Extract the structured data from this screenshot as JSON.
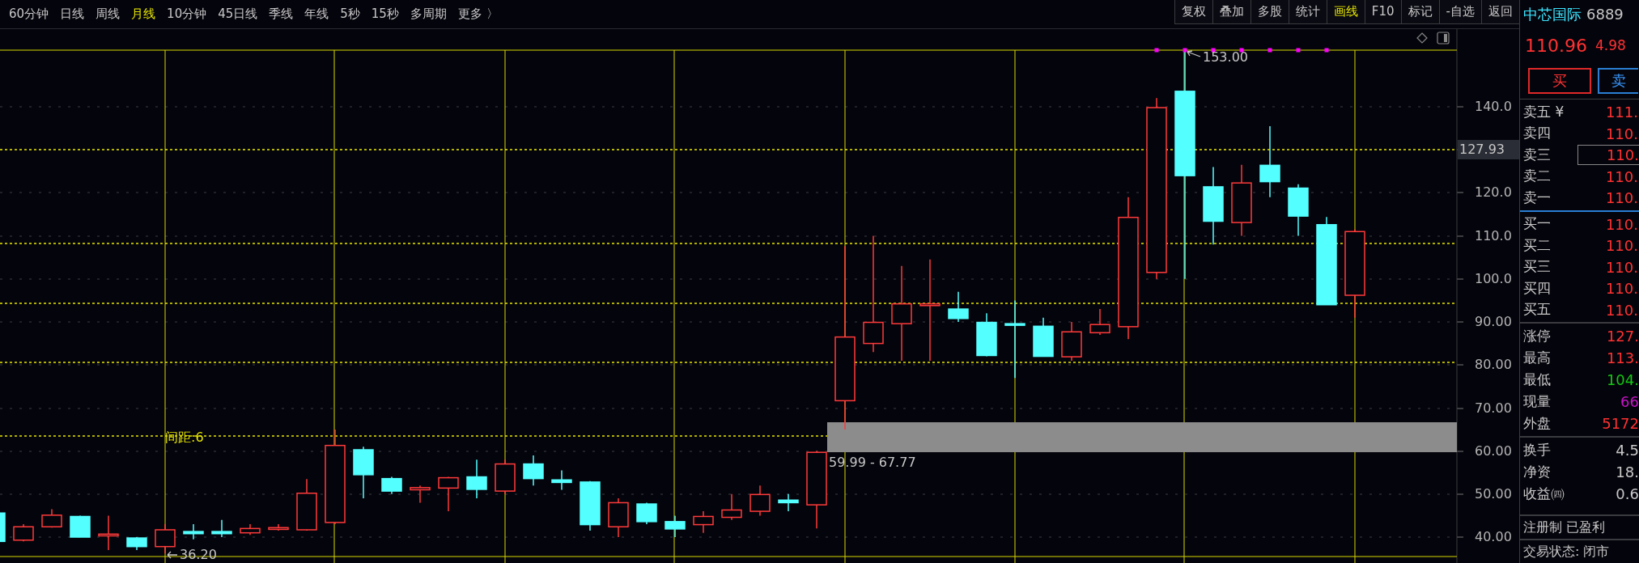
{
  "period_tabs": [
    {
      "label": "60分钟",
      "selected": false
    },
    {
      "label": "日线",
      "selected": false
    },
    {
      "label": "周线",
      "selected": false
    },
    {
      "label": "月线",
      "selected": true
    },
    {
      "label": "10分钟",
      "selected": false
    },
    {
      "label": "45日线",
      "selected": false
    },
    {
      "label": "季线",
      "selected": false
    },
    {
      "label": "年线",
      "selected": false
    },
    {
      "label": "5秒",
      "selected": false
    },
    {
      "label": "15秒",
      "selected": false
    },
    {
      "label": "多周期",
      "selected": false
    },
    {
      "label": "更多 〉",
      "selected": false
    }
  ],
  "tools": [
    {
      "label": "复权",
      "selected": false
    },
    {
      "label": "叠加",
      "selected": false
    },
    {
      "label": "多股",
      "selected": false
    },
    {
      "label": "统计",
      "selected": false
    },
    {
      "label": "画线",
      "selected": true
    },
    {
      "label": "F10",
      "selected": false
    },
    {
      "label": "标记",
      "selected": false
    },
    {
      "label": "-自选",
      "selected": false
    },
    {
      "label": "返回",
      "selected": false
    }
  ],
  "chart": {
    "price_axis": [
      {
        "label": "140.0",
        "kind": "tick"
      },
      {
        "label": "127.93",
        "kind": "marker"
      },
      {
        "label": "120.0",
        "kind": "tick"
      },
      {
        "label": "110.0",
        "kind": "tick"
      },
      {
        "label": "100.0",
        "kind": "tick"
      },
      {
        "label": "90.00",
        "kind": "tick"
      },
      {
        "label": "80.00",
        "kind": "tick"
      },
      {
        "label": "70.00",
        "kind": "tick"
      },
      {
        "label": "60.00",
        "kind": "tick"
      },
      {
        "label": "50.00",
        "kind": "tick"
      },
      {
        "label": "40.00",
        "kind": "tick"
      }
    ],
    "high_label": "153.00",
    "low_label": "36.20",
    "spacing_label": "间距:6",
    "range_label": "59.99 - 67.77"
  },
  "quote": {
    "name": "中芯国际",
    "code": "6889",
    "price": "110.96",
    "change": "4.98",
    "buy": "买",
    "sell": "卖"
  },
  "asks": [
    {
      "label": "卖五 ¥",
      "value": "111.",
      "selected": false
    },
    {
      "label": "卖四",
      "value": "110.",
      "selected": false
    },
    {
      "label": "卖三",
      "value": "110.",
      "selected": true
    },
    {
      "label": "卖二",
      "value": "110.",
      "selected": false
    },
    {
      "label": "卖一",
      "value": "110.",
      "selected": false
    }
  ],
  "bids": [
    {
      "label": "买一",
      "value": "110.",
      "selected": false
    },
    {
      "label": "买二",
      "value": "110.",
      "selected": false
    },
    {
      "label": "买三",
      "value": "110.",
      "selected": false
    },
    {
      "label": "买四",
      "value": "110.",
      "selected": false
    },
    {
      "label": "买五",
      "value": "110.",
      "selected": false
    }
  ],
  "limits": [
    {
      "label": "涨停",
      "value": "127.",
      "color": "#ff3232"
    },
    {
      "label": "最高",
      "value": "113.",
      "color": "#ff3232"
    },
    {
      "label": "最低",
      "value": "104.",
      "color": "#14c814"
    },
    {
      "label": "现量",
      "value": "66",
      "color": "#c814c8"
    },
    {
      "label": "外盘",
      "value": "5172",
      "color": "#ff3232"
    }
  ],
  "fundamentals": [
    {
      "label": "换手",
      "value": "4.5"
    },
    {
      "label": "净资",
      "value": "18."
    },
    {
      "label": "收益㈣",
      "value": "0.6"
    }
  ],
  "tags": "注册制 已盈利",
  "trade_status": "交易状态: 闭市"
}
